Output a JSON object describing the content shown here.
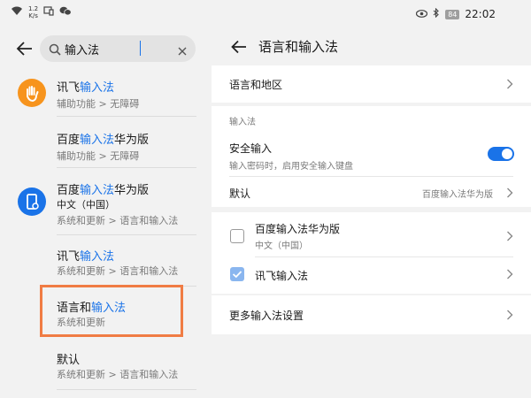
{
  "status_bar": {
    "net_speed_value": "1.2",
    "net_speed_unit": "K/s",
    "battery": "84",
    "time": "22:02"
  },
  "search": {
    "value": "输入法"
  },
  "results": [
    {
      "title_plain": "讯飞",
      "title_hl": "输入法",
      "title_rest": "",
      "sub": "辅助功能 > 无障碍",
      "icon": "hand-accessibility-icon"
    },
    {
      "title_plain": "百度",
      "title_hl": "输入法",
      "title_rest": "华为版",
      "sub": "辅助功能 > 无障碍"
    },
    {
      "title_plain": "百度",
      "title_hl": "输入法",
      "title_rest": "华为版",
      "sub": "中文（中国）",
      "sub2": "系统和更新 > 语言和输入法",
      "icon": "system-phone-icon"
    },
    {
      "title_plain": "讯飞",
      "title_hl": "输入法",
      "title_rest": "",
      "sub": "系统和更新 > 语言和输入法"
    },
    {
      "title_plain": "语言和",
      "title_hl": "输入法",
      "title_rest": "",
      "sub": "系统和更新"
    },
    {
      "title_plain": "默认",
      "title_hl": "",
      "title_rest": "",
      "sub": "系统和更新 > 语言和输入法"
    }
  ],
  "detail": {
    "title": "语言和输入法",
    "language_region": "语言和地区",
    "section_input_method": "输入法",
    "secure_input": "安全输入",
    "secure_input_desc": "输入密码时，启用安全输入键盘",
    "secure_input_enabled": true,
    "default_label": "默认",
    "default_value": "百度输入法华为版",
    "methods": [
      {
        "name": "百度输入法华为版",
        "sub": "中文（中国）",
        "checked": false
      },
      {
        "name": "讯飞输入法",
        "sub": "",
        "checked": true
      }
    ],
    "more_settings": "更多输入法设置"
  },
  "colors": {
    "accent": "#1a73e8",
    "highlight_box": "#f07c44",
    "accessibility_icon": "#f7941d",
    "system_icon": "#1a73e8"
  }
}
